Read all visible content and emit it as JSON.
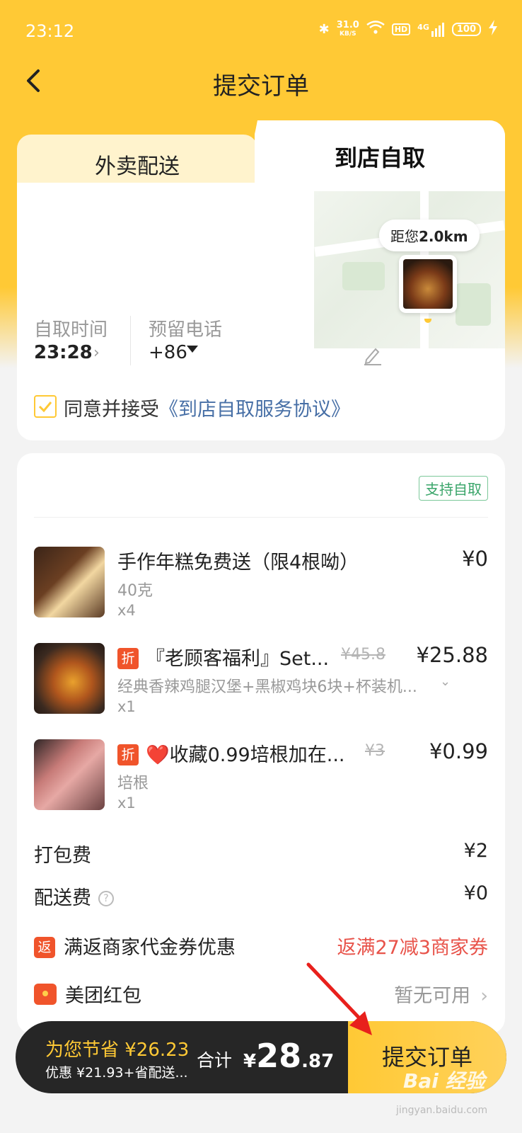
{
  "status": {
    "time": "23:12",
    "speed_value": "31.0",
    "speed_unit": "KB/S",
    "hd": "HD",
    "network": "4G",
    "battery": "100"
  },
  "nav": {
    "title": "提交订单"
  },
  "tabs": {
    "delivery": "外卖配送",
    "pickup": "到店自取"
  },
  "map": {
    "distance_prefix": "距您",
    "distance_value": "2.0km"
  },
  "pickup_info": {
    "time_label": "自取时间",
    "time_value": "23:28",
    "phone_label": "预留电话",
    "phone_value": "+86"
  },
  "agreement": {
    "text": "同意并接受",
    "link": "《到店自取服务协议》"
  },
  "order": {
    "support_badge": "支持自取",
    "items": [
      {
        "name": "手作年糕免费送（限4根呦）",
        "sub": "40克",
        "qty": "x4",
        "price": "¥0",
        "original_price": ""
      },
      {
        "tag": "折",
        "name": "『老顾客福利』Set...",
        "sub": "经典香辣鸡腿汉堡+黑椒鸡块6块+杯装机...",
        "qty": "x1",
        "price": "¥25.88",
        "original_price": "¥45.8"
      },
      {
        "tag": "折",
        "name": "❤️收藏0.99培根加在...",
        "sub": "培根",
        "qty": "x1",
        "price": "¥0.99",
        "original_price": "¥3"
      }
    ],
    "packing_label": "打包费",
    "packing_value": "¥2",
    "delivery_label": "配送费",
    "delivery_value": "¥0",
    "rebate_tag": "返",
    "rebate_label": "满返商家代金券优惠",
    "rebate_value": "返满27减3商家券",
    "redpack_label": "美团红包",
    "redpack_value": "暂无可用"
  },
  "bottom": {
    "save_text": "为您节省 ¥26.23",
    "save_detail": "优惠 ¥21.93+省配送...",
    "total_label": "合计",
    "total_currency": "¥",
    "total_int": "28",
    "total_dec": ".87",
    "submit_label": "提交订单"
  },
  "watermark": {
    "text": "Bai 经验",
    "sub": "jingyan.baidu.com"
  },
  "colors": {
    "brand_yellow": "#ffc935",
    "accent_red": "#f0542b",
    "link_blue": "#476fa6",
    "green": "#3aa56a"
  }
}
